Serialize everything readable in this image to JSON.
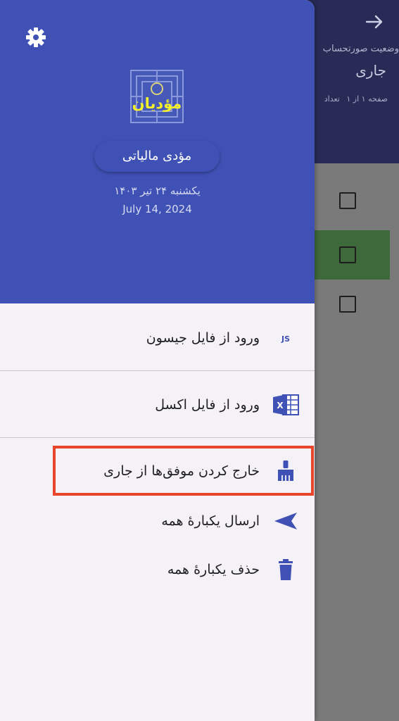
{
  "background": {
    "title": "وضعیت صورتحساب",
    "subtitle": "جاری",
    "pager": {
      "page": "صفحه ۱ از ۱",
      "count": "تعداد"
    },
    "header_color": "#272b56",
    "selected_row_color": "#3e6a3b"
  },
  "drawer": {
    "logo_text": "مؤدیان",
    "profile_name": "مؤدی مالیاتی",
    "date_persian": "یکشنبه ۲۴ تیر ۱۴۰۳",
    "date_gregorian": "July 14, 2024",
    "header_color": "#3f51b5",
    "menu": {
      "import_json": {
        "label": "ورود از فایل جیسون",
        "icon": "js-file-icon"
      },
      "import_excel": {
        "label": "ورود از فایل اکسل",
        "icon": "excel-icon"
      },
      "remove_successful": {
        "label": "خارج کردن موفق‌ها از جاری",
        "icon": "broom-icon"
      },
      "send_all": {
        "label": "ارسال یکبارهٔ همه",
        "icon": "send-icon"
      },
      "delete_all": {
        "label": "حذف یکبارهٔ همه",
        "icon": "trash-icon"
      }
    }
  },
  "highlight_color": "#e8452c"
}
